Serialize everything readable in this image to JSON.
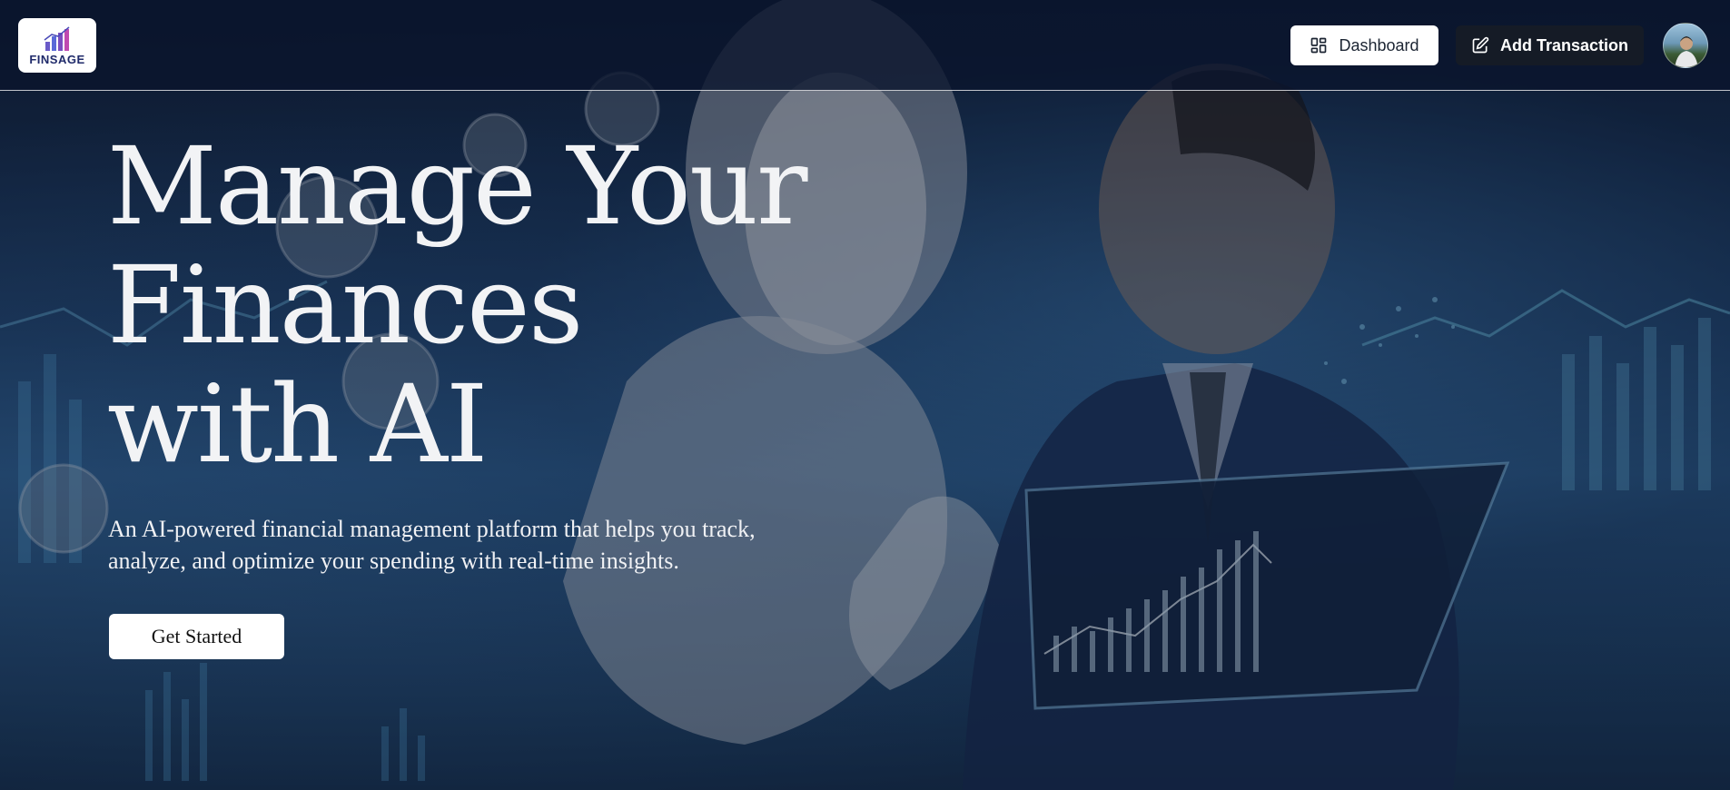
{
  "header": {
    "logo_text": "FINSAGE",
    "dashboard_label": "Dashboard",
    "add_transaction_label": "Add Transaction",
    "dashboard_icon": "layout-grid-icon",
    "add_transaction_icon": "pen-square-icon",
    "avatar": "user-avatar"
  },
  "hero": {
    "title_lines": [
      "Manage Your",
      "Finances",
      "with AI"
    ],
    "subtitle_line1": "An AI-powered financial management platform that helps you track,",
    "subtitle_line2": "analyze, and optimize your spending with real-time insights.",
    "cta_label": "Get Started"
  },
  "colors": {
    "header_bg": "#0a142d",
    "primary_button_bg": "#151b26",
    "secondary_button_bg": "#ffffff",
    "hero_text": "#f2f3f5"
  }
}
